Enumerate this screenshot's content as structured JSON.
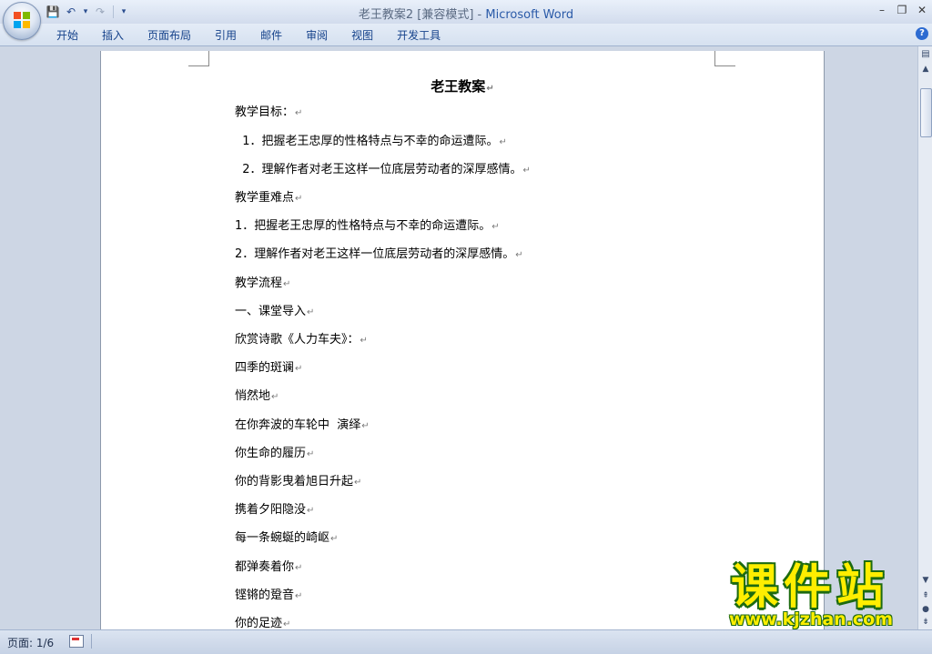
{
  "titlebar": {
    "title": "老王教案2 [兼容模式] - ",
    "app_name": "Microsoft Word",
    "minimize": "–",
    "restore": "❐",
    "close": "✕"
  },
  "qat": {
    "save": "💾",
    "undo": "↶",
    "undo_drop": "▾",
    "redo": "↷",
    "customize": "▾"
  },
  "ribbon": {
    "tabs": [
      "开始",
      "插入",
      "页面布局",
      "引用",
      "邮件",
      "审阅",
      "视图",
      "开发工具"
    ],
    "help": "?"
  },
  "document": {
    "title": "老王教案",
    "lines": [
      "教学目标：",
      "  1．把握老王忠厚的性格特点与不幸的命运遭际。",
      "  2．理解作者对老王这样一位底层劳动者的深厚感情。",
      "教学重难点",
      "1．把握老王忠厚的性格特点与不幸的命运遭际。",
      "2．理解作者对老王这样一位底层劳动者的深厚感情。",
      "教学流程",
      "一、课堂导入",
      "欣赏诗歌《人力车夫》：",
      "四季的斑谰",
      "悄然地",
      "在你奔波的车轮中  演绎",
      "你生命的履历",
      "你的背影曳着旭日升起",
      "携着夕阳隐没",
      "每一条蜿蜒的崎岖",
      "都弹奏着你",
      "铿锵的跫音",
      "你的足迹"
    ],
    "paragraph_mark": "↵"
  },
  "statusbar": {
    "page_info": "页面: 1/6"
  },
  "watermark": {
    "text": "课件站",
    "url": "www.kjzhan.com"
  }
}
